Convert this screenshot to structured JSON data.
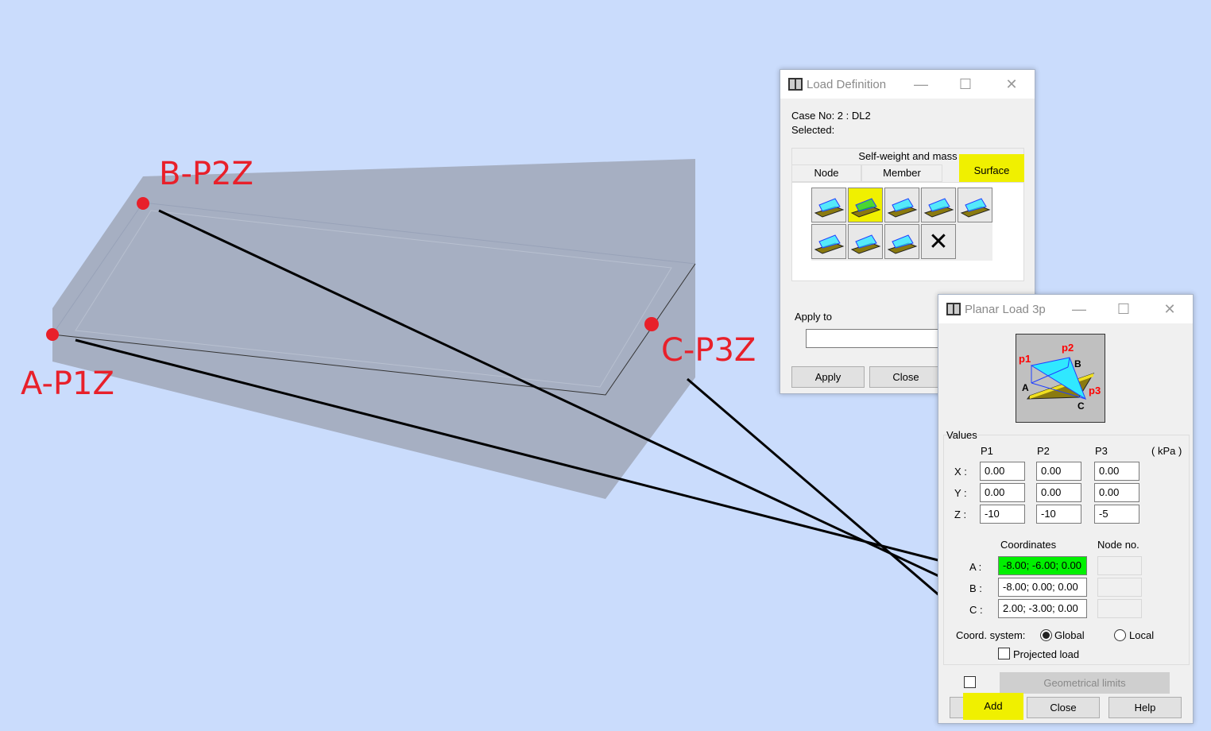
{
  "scene": {
    "point_labels": [
      "A-P1Z",
      "B-P2Z",
      "C-P3Z"
    ],
    "slab_color": "#a6afc2",
    "point_color": "#e8202a"
  },
  "load_definition": {
    "title": "Load Definition",
    "case_no": "Case No: 2 : DL2",
    "selected": "Selected:",
    "tabs": {
      "self_weight": "Self-weight and mass",
      "node": "Node",
      "member": "Member",
      "surface": "Surface"
    },
    "active_tab": "Surface",
    "tools": [
      "uniform-planar-load",
      "planar-load-3p",
      "linear-load",
      "hydrostatic-load",
      "thermal-load",
      "uniform-contour-load",
      "contour-load",
      "linear-contour-load",
      "delete-load"
    ],
    "apply_to_label": "Apply to",
    "apply_to_value": "",
    "apply_button": "Apply",
    "close_button": "Close"
  },
  "planar_load": {
    "title": "Planar Load 3p",
    "diagram_labels": {
      "p1": "p1",
      "p2": "p2",
      "p3": "p3",
      "a": "A",
      "b": "B",
      "c": "C"
    },
    "values_label": "Values",
    "columns": [
      "P1",
      "P2",
      "P3"
    ],
    "unit": "( kPa )",
    "rows": [
      {
        "label": "X :",
        "values": [
          "0.00",
          "0.00",
          "0.00"
        ]
      },
      {
        "label": "Y :",
        "values": [
          "0.00",
          "0.00",
          "0.00"
        ]
      },
      {
        "label": "Z :",
        "values": [
          "-10",
          "-10",
          "-5"
        ]
      }
    ],
    "coordinates_label": "Coordinates",
    "node_no_label": "Node no.",
    "points": [
      {
        "label": "A :",
        "coords": "-8.00; -6.00; 0.00",
        "node": ""
      },
      {
        "label": "B :",
        "coords": "-8.00; 0.00; 0.00",
        "node": ""
      },
      {
        "label": "C :",
        "coords": "2.00; -3.00; 0.00",
        "node": ""
      }
    ],
    "coord_system_label": "Coord. system:",
    "global_label": "Global",
    "local_label": "Local",
    "coord_system_selected": "Global",
    "projected_load_label": "Projected load",
    "projected_load_checked": false,
    "geometrical_limits_checked": false,
    "geometrical_limits_button": "Geometrical limits",
    "add_button": "Add",
    "close_button": "Close",
    "help_button": "Help",
    "highlight_color": "#f0f000",
    "active_field_color": "#00f000"
  }
}
